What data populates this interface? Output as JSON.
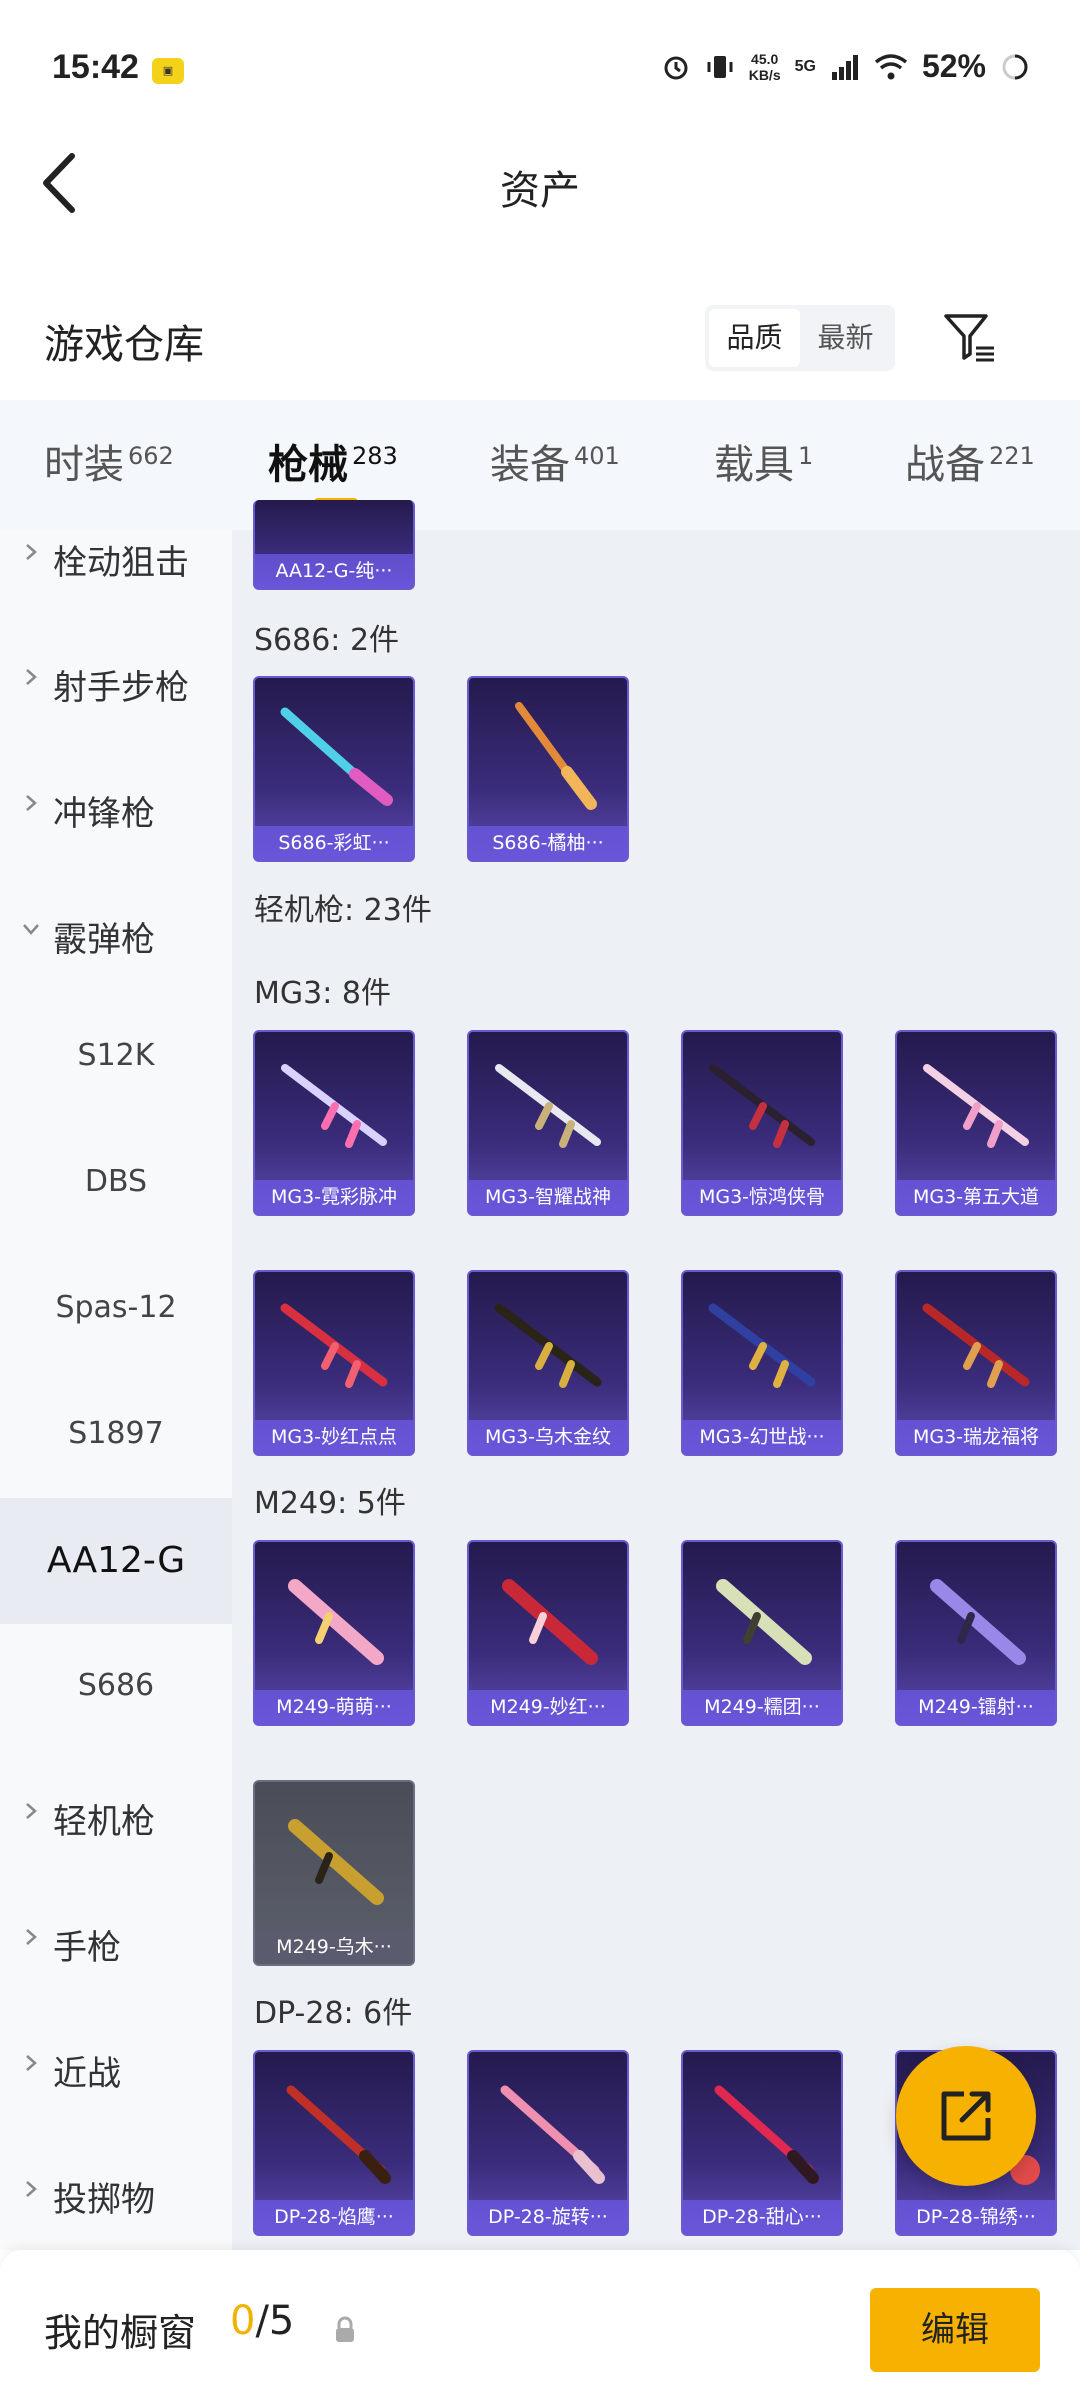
{
  "status_bar": {
    "time": "15:42",
    "speed_top": "45.0",
    "speed_bottom": "KB/s",
    "network": "5G",
    "battery": "52%"
  },
  "header": {
    "title": "资产"
  },
  "section": {
    "title": "游戏仓库",
    "sort_options": [
      "品质",
      "最新"
    ],
    "active_sort": "品质"
  },
  "tabs": [
    {
      "label": "时装",
      "count": "662"
    },
    {
      "label": "枪械",
      "count": "283"
    },
    {
      "label": "装备",
      "count": "401"
    },
    {
      "label": "载具",
      "count": "1"
    },
    {
      "label": "战备",
      "count": "221"
    }
  ],
  "active_tab": "枪械",
  "sidebar": {
    "categories": [
      {
        "label": "栓动狙击"
      },
      {
        "label": "射手步枪"
      },
      {
        "label": "冲锋枪"
      },
      {
        "label": "霰弹枪"
      },
      {
        "label": "轻机枪"
      },
      {
        "label": "手枪"
      },
      {
        "label": "近战"
      },
      {
        "label": "投掷物"
      }
    ],
    "subitems": [
      "S12K",
      "DBS",
      "Spas-12",
      "S1897",
      "AA12-G",
      "S686"
    ],
    "selected_sub": "AA12-G"
  },
  "content": {
    "top_partial_card": "AA12-G-纯···",
    "groups": [
      {
        "label": "S686: 2件",
        "items": [
          "S686-彩虹···",
          "S686-橘柚···"
        ]
      },
      {
        "label": "轻机枪: 23件"
      },
      {
        "label": "MG3: 8件",
        "items": [
          "MG3-霓彩脉冲",
          "MG3-智耀战神",
          "MG3-惊鸿侠骨",
          "MG3-第五大道",
          "MG3-妙红点点",
          "MG3-乌木金纹",
          "MG3-幻世战···",
          "MG3-瑞龙福将"
        ]
      },
      {
        "label": "M249: 5件",
        "items": [
          "M249-萌萌···",
          "M249-妙红···",
          "M249-糯团···",
          "M249-镭射···",
          "M249-乌木···"
        ]
      },
      {
        "label": "DP-28: 6件",
        "items": [
          "DP-28-焰鹰···",
          "DP-28-旋转···",
          "DP-28-甜心···",
          "DP-28-锦绣···"
        ]
      }
    ]
  },
  "bottom": {
    "title": "我的橱窗",
    "current": "0",
    "total": "/5",
    "edit_label": "编辑"
  },
  "icons": [
    "back-arrow-icon",
    "filter-icon",
    "share-external-icon",
    "lock-icon",
    "chevron-right-icon",
    "chevron-down-icon"
  ]
}
